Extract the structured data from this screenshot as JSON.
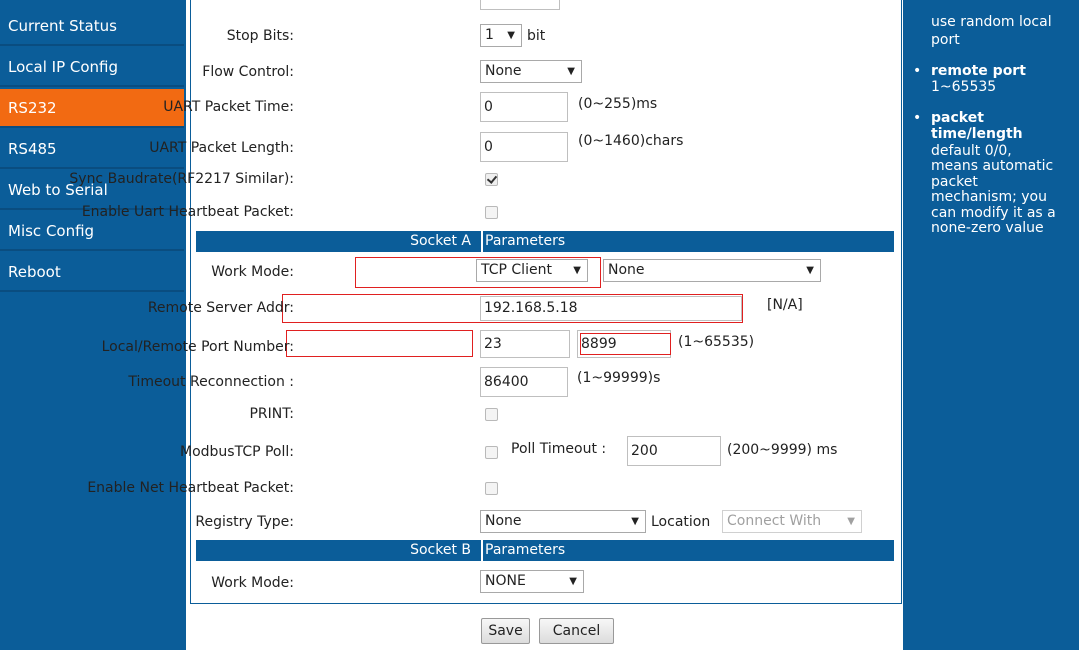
{
  "sidebar": {
    "items": [
      {
        "label": "Current Status"
      },
      {
        "label": "Local IP Config"
      },
      {
        "label": "RS232"
      },
      {
        "label": "RS485"
      },
      {
        "label": "Web to Serial"
      },
      {
        "label": "Misc Config"
      },
      {
        "label": "Reboot"
      }
    ],
    "active_index": 2
  },
  "form": {
    "stop_bits": {
      "label": "Stop Bits:",
      "value": "1",
      "unit": "bit"
    },
    "flow_control": {
      "label": "Flow Control:",
      "value": "None"
    },
    "uart_packet_time": {
      "label": "UART Packet Time:",
      "value": "0",
      "hint": "(0~255)ms"
    },
    "uart_packet_length": {
      "label": "UART Packet Length:",
      "value": "0",
      "hint": "(0~1460)chars"
    },
    "sync_baudrate": {
      "label": "Sync Baudrate(RF2217 Similar):",
      "checked": true
    },
    "uart_heartbeat": {
      "label": "Enable Uart Heartbeat Packet:",
      "checked": false
    },
    "socket_a": {
      "left": "Socket A",
      "right": "Parameters"
    },
    "work_mode": {
      "label": "Work Mode:",
      "value": "TCP Client",
      "secondary": "None"
    },
    "remote_server": {
      "label": "Remote Server Addr:",
      "value": "192.168.5.18",
      "status": "[N/A]"
    },
    "port_number": {
      "label": "Local/Remote Port Number:",
      "local": "23",
      "remote": "8899",
      "hint": "(1~65535)"
    },
    "timeout_reconnect": {
      "label": "Timeout Reconnection :",
      "value": "86400",
      "hint": "(1~99999)s"
    },
    "print": {
      "label": "PRINT:",
      "checked": false
    },
    "modbus_poll": {
      "label": "ModbusTCP Poll:",
      "checked": false,
      "poll_timeout_label": "Poll Timeout :",
      "poll_timeout": "200",
      "hint": "(200~9999) ms"
    },
    "net_heartbeat": {
      "label": "Enable Net Heartbeat Packet:",
      "checked": false
    },
    "registry": {
      "label": "Registry Type:",
      "value": "None",
      "location_label": "Location",
      "location_value": "Connect With"
    },
    "socket_b": {
      "left": "Socket B",
      "right": "Parameters"
    },
    "work_mode_b": {
      "label": "Work Mode:",
      "value": "NONE"
    },
    "save": "Save",
    "cancel": "Cancel"
  },
  "help": {
    "top_lines": [
      "use random local",
      "port"
    ],
    "remote_port_title": "remote port",
    "remote_port_range": "1~65535",
    "packet_title_1": "packet",
    "packet_title_2": "time/length",
    "packet_lines": [
      "default 0/0,",
      "means automatic",
      "packet",
      "mechanism; you",
      "can modify it as a",
      "none-zero value"
    ]
  },
  "colors": {
    "nav_bg": "#0b5d99",
    "nav_active": "#f26a12",
    "highlight": "#e02020"
  }
}
